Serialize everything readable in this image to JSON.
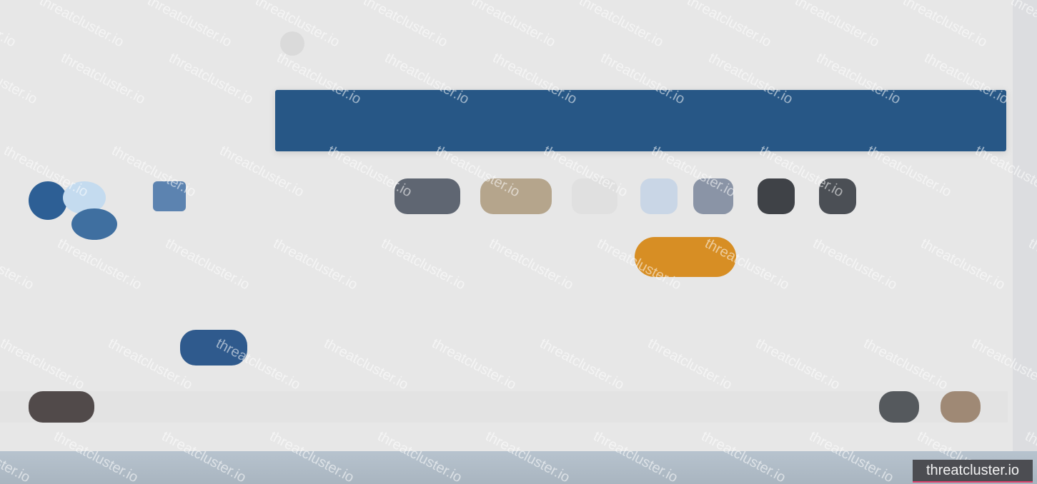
{
  "watermark": {
    "text": "threatcluster.io"
  },
  "badge": {
    "text": "threatcluster.io"
  },
  "colors": {
    "banner": "#275786",
    "accent_button": "#d78e24",
    "secondary_button": "#2f5a8d",
    "bottom_bar": "#b7c3ce"
  },
  "toolbar": {
    "buttons": [
      {
        "name": "tool-button-1"
      },
      {
        "name": "tool-button-2"
      },
      {
        "name": "tool-button-3"
      },
      {
        "name": "tool-button-4"
      },
      {
        "name": "tool-button-5"
      },
      {
        "name": "tool-button-6"
      },
      {
        "name": "tool-button-7"
      }
    ]
  }
}
